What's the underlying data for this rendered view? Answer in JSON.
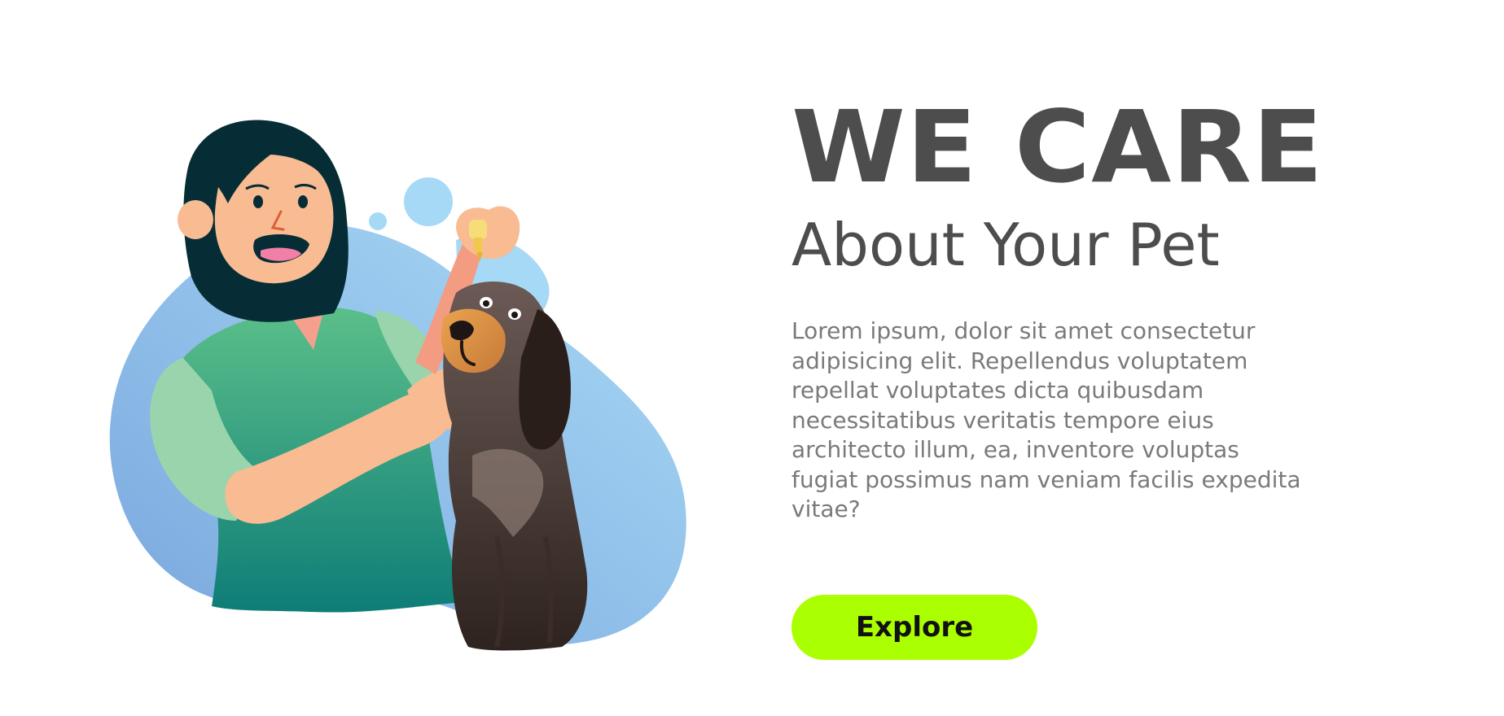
{
  "hero": {
    "headline": "WE CARE",
    "subheadline": "About Your Pet",
    "description": "Lorem ipsum, dolor sit amet consectetur adipisicing elit. Repellendus voluptatem repellat voluptates dicta quibusdam necessitatibus veritatis tempore eius architecto illum, ea, inventore voluptas fugiat possimus nam veniam facilis expedita vitae?",
    "button_label": "Explore"
  },
  "illustration": {
    "subject": "woman-giving-eye-drops-to-dog-illustration"
  },
  "colors": {
    "heading": "#4d4d4d",
    "body_text": "#7a7a7a",
    "button_bg": "#aaff00",
    "blob_light": "#a6d9f5",
    "blob_mid": "#7fb2e5",
    "shirt": "#2aa37a",
    "dog": "#4a3b36"
  }
}
